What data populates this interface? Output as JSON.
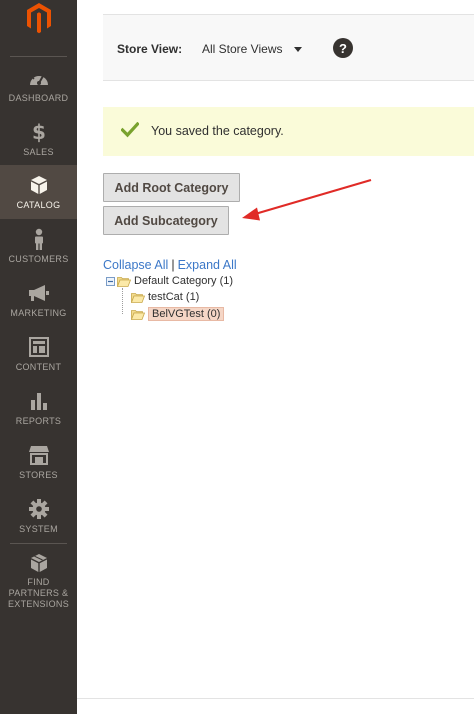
{
  "sidebar": {
    "logo_icon": "magento-logo",
    "items": [
      {
        "id": "dashboard",
        "label": "DASHBOARD",
        "icon": "dashboard-icon"
      },
      {
        "id": "sales",
        "label": "SALES",
        "icon": "dollar-icon"
      },
      {
        "id": "catalog",
        "label": "CATALOG",
        "icon": "box-icon",
        "active": true
      },
      {
        "id": "customers",
        "label": "CUSTOMERS",
        "icon": "person-icon"
      },
      {
        "id": "marketing",
        "label": "MARKETING",
        "icon": "megaphone-icon"
      },
      {
        "id": "content",
        "label": "CONTENT",
        "icon": "layout-icon"
      },
      {
        "id": "reports",
        "label": "REPORTS",
        "icon": "bar-chart-icon"
      },
      {
        "id": "stores",
        "label": "STORES",
        "icon": "storefront-icon"
      },
      {
        "id": "system",
        "label": "SYSTEM",
        "icon": "gear-icon"
      },
      {
        "id": "partners",
        "label": "FIND PARTNERS & EXTENSIONS",
        "icon": "cubes-icon"
      }
    ]
  },
  "store_switcher": {
    "label": "Store View:",
    "selected": "All Store Views"
  },
  "help": {
    "glyph": "?"
  },
  "message": {
    "text": "You saved the category.",
    "color": "#79a22e"
  },
  "buttons": {
    "add_root": "Add Root Category",
    "add_sub": "Add Subcategory"
  },
  "tree": {
    "collapse_all": "Collapse All",
    "separator": "|",
    "expand_all": "Expand All",
    "nodes": [
      {
        "label": "Default Category (1)",
        "level": 0
      },
      {
        "label": "testCat (1)",
        "level": 1
      },
      {
        "label": "BelVGTest (0)",
        "level": 1,
        "selected": true
      }
    ]
  },
  "annotation": {
    "arrow_color": "#e02b27"
  }
}
